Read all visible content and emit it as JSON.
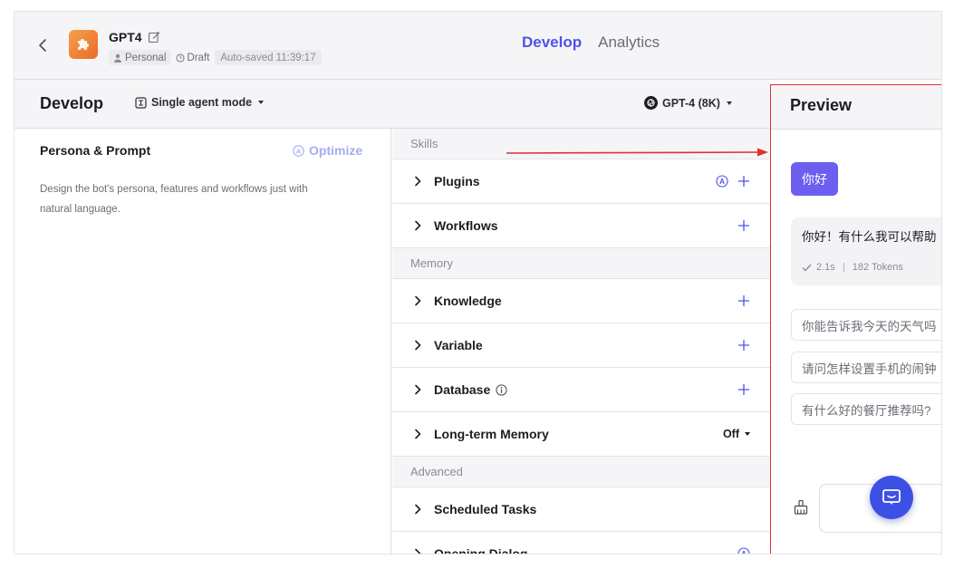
{
  "topbar": {
    "bot_name": "GPT4",
    "personal_label": "Personal",
    "draft_label": "Draft",
    "autosaved_label": "Auto-saved 11:39:17",
    "tabs": {
      "develop": "Develop",
      "analytics": "Analytics"
    }
  },
  "dev_header": {
    "title": "Develop",
    "mode": "Single agent mode",
    "model": "GPT-4 (8K)"
  },
  "persona": {
    "title": "Persona & Prompt",
    "optimize_label": "Optimize",
    "description": "Design the bot's persona, features and workflows just with natural language."
  },
  "skills": {
    "skills_label": "Skills",
    "plugins": "Plugins",
    "workflows": "Workflows",
    "memory_label": "Memory",
    "knowledge": "Knowledge",
    "variable": "Variable",
    "database": "Database",
    "long_term_memory": "Long-term Memory",
    "long_term_memory_value": "Off",
    "advanced_label": "Advanced",
    "scheduled_tasks": "Scheduled Tasks",
    "opening_dialog": "Opening Dialog"
  },
  "preview": {
    "title": "Preview",
    "user_message": "你好",
    "bot_message": "你好！有什么我可以帮助",
    "response_time": "2.1s",
    "tokens": "182 Tokens",
    "suggestions": [
      "你能告诉我今天的天气吗",
      "请问怎样设置手机的闹钟",
      "有什么好的餐厅推荐吗?"
    ]
  },
  "colors": {
    "accent": "#4d53e8",
    "user_bubble": "#6c5ff0",
    "fab": "#3d50e6",
    "annotation": "#e03030",
    "avatar_orange": "#ea6a2a"
  }
}
